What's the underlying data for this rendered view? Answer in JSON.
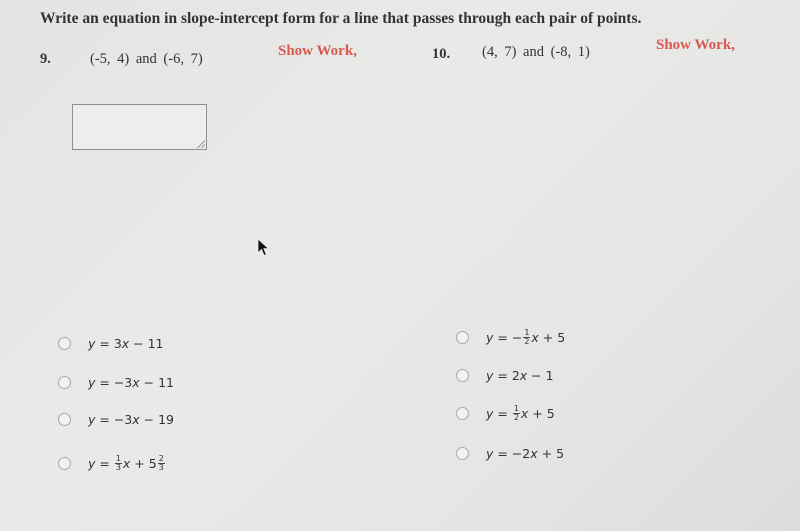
{
  "instructions": "Write an equation in slope-intercept form for a line that passes through each pair of points.",
  "questions": [
    {
      "number": "9.",
      "points": "(-5, 4)  and  (-6, 7)",
      "show_work": "Show Work,",
      "answer_box_value": "",
      "options": [
        {
          "parts": [
            "y",
            " = 3",
            "x",
            " − 11"
          ]
        },
        {
          "parts": [
            "y",
            " = −3",
            "x",
            " − 11"
          ]
        },
        {
          "parts": [
            "y",
            " = −3",
            "x",
            " − 19"
          ]
        },
        {
          "prefix": "y",
          "eq": " = ",
          "frac1": {
            "num": "1",
            "den": "3"
          },
          "mid_var": "x",
          "mid": " + 5",
          "frac2": {
            "num": "2",
            "den": "3"
          }
        }
      ]
    },
    {
      "number": "10.",
      "points": "(4, 7)  and  (-8, 1)",
      "show_work": "Show Work,",
      "options": [
        {
          "prefix": "y",
          "eq": " = −",
          "frac1": {
            "num": "1",
            "den": "2"
          },
          "mid_var": "x",
          "mid": " + 5"
        },
        {
          "parts": [
            "y",
            " = 2",
            "x",
            " − 1"
          ]
        },
        {
          "prefix": "y",
          "eq": " = ",
          "frac1": {
            "num": "1",
            "den": "2"
          },
          "mid_var": "x",
          "mid": " + 5"
        },
        {
          "parts": [
            "y",
            " = −2",
            "x",
            " + 5"
          ]
        }
      ]
    }
  ],
  "colors": {
    "show_work": "#d9584f",
    "text": "#333333",
    "background": "#e6e7e5"
  }
}
